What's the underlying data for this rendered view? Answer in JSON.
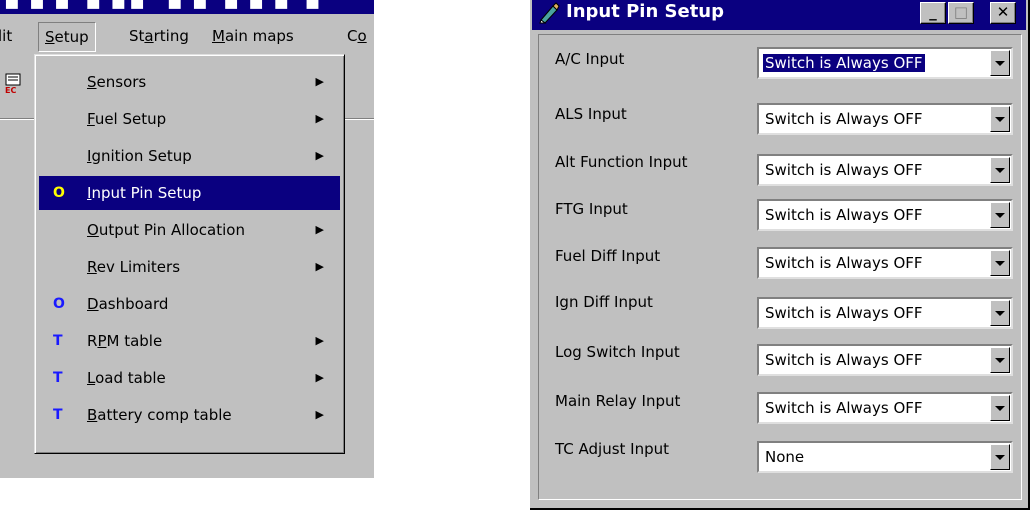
{
  "left": {
    "menubar": [
      "lit",
      "Setup",
      "Starting",
      "Main maps",
      "Co"
    ],
    "menu_items": [
      {
        "mark": "",
        "label": "Sensors",
        "underline": "S",
        "rest": "ensors",
        "submenu": true
      },
      {
        "mark": "",
        "label": "Fuel Setup",
        "underline": "F",
        "rest": "uel Setup",
        "submenu": true
      },
      {
        "mark": "",
        "label": "Ignition Setup",
        "underline": "I",
        "rest": "gnition Setup",
        "submenu": true
      },
      {
        "mark": "O",
        "label": "Input Pin Setup",
        "underline": "I",
        "rest": "nput Pin Setup",
        "submenu": false,
        "selected": true
      },
      {
        "mark": "",
        "label": "Output Pin Allocation",
        "underline": "O",
        "rest": "utput Pin Allocation",
        "submenu": true
      },
      {
        "mark": "",
        "label": "Rev Limiters",
        "underline": "R",
        "rest": "ev Limiters",
        "submenu": true
      },
      {
        "mark": "O",
        "label": "Dashboard",
        "underline": "D",
        "rest": "ashboard",
        "submenu": false
      },
      {
        "mark": "T",
        "label": "RPM table",
        "underline": "R",
        "rest": "PM table",
        "submenu": true
      },
      {
        "mark": "T",
        "label": "Load table",
        "underline": "L",
        "rest": "oad table",
        "submenu": true
      },
      {
        "mark": "T",
        "label": "Battery comp table",
        "underline": "B",
        "rest": "attery comp table",
        "submenu": true
      }
    ]
  },
  "dialog": {
    "title": "Input Pin Setup",
    "buttons": {
      "minimize": "_",
      "maximize": "□",
      "close": "✕"
    },
    "rows": [
      {
        "label": "A/C Input",
        "value": "Switch is Always OFF"
      },
      {
        "label": "ALS Input",
        "value": "Switch is Always OFF"
      },
      {
        "label": "Alt Function Input",
        "value": "Switch is Always OFF"
      },
      {
        "label": "FTG Input",
        "value": "Switch is Always OFF"
      },
      {
        "label": "Fuel Diff Input",
        "value": "Switch is Always OFF"
      },
      {
        "label": "Ign Diff Input",
        "value": "Switch is Always OFF"
      },
      {
        "label": "Log Switch Input",
        "value": "Switch is Always OFF"
      },
      {
        "label": "Main Relay Input",
        "value": "Switch is Always OFF"
      },
      {
        "label": "TC Adjust Input",
        "value": "None"
      }
    ]
  }
}
